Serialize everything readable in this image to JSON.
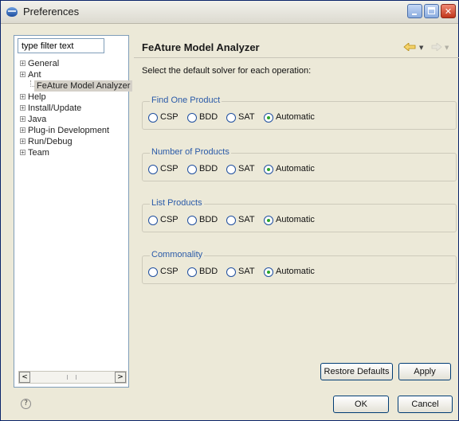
{
  "window": {
    "title": "Preferences"
  },
  "sidebar": {
    "filter_placeholder": "type filter text",
    "items": [
      {
        "label": "General",
        "expander": "+"
      },
      {
        "label": "Ant",
        "expander": "+"
      },
      {
        "label": "FeAture Model Analyzer",
        "selected": true
      },
      {
        "label": "Help",
        "expander": "+"
      },
      {
        "label": "Install/Update",
        "expander": "+"
      },
      {
        "label": "Java",
        "expander": "+"
      },
      {
        "label": "Plug-in Development",
        "expander": "+"
      },
      {
        "label": "Run/Debug",
        "expander": "+"
      },
      {
        "label": "Team",
        "expander": "+"
      }
    ],
    "scroll_left": "<",
    "scroll_right": ">"
  },
  "page": {
    "title": "FeAture Model Analyzer",
    "description": "Select the default solver for each operation:",
    "groups": [
      {
        "label": "Find One Product",
        "options": [
          "CSP",
          "BDD",
          "SAT",
          "Automatic"
        ],
        "selected": "Automatic"
      },
      {
        "label": "Number of Products",
        "options": [
          "CSP",
          "BDD",
          "SAT",
          "Automatic"
        ],
        "selected": "Automatic"
      },
      {
        "label": "List Products",
        "options": [
          "CSP",
          "BDD",
          "SAT",
          "Automatic"
        ],
        "selected": "Automatic"
      },
      {
        "label": "Commonality",
        "options": [
          "CSP",
          "BDD",
          "SAT",
          "Automatic"
        ],
        "selected": "Automatic"
      }
    ],
    "restore_label": "Restore Defaults",
    "apply_label": "Apply"
  },
  "footer": {
    "help_glyph": "?",
    "ok_label": "OK",
    "cancel_label": "Cancel"
  },
  "colors": {
    "legend": "#2a5aa8",
    "radio_selected": "#2aa52a",
    "close_button": "#c0361b"
  }
}
